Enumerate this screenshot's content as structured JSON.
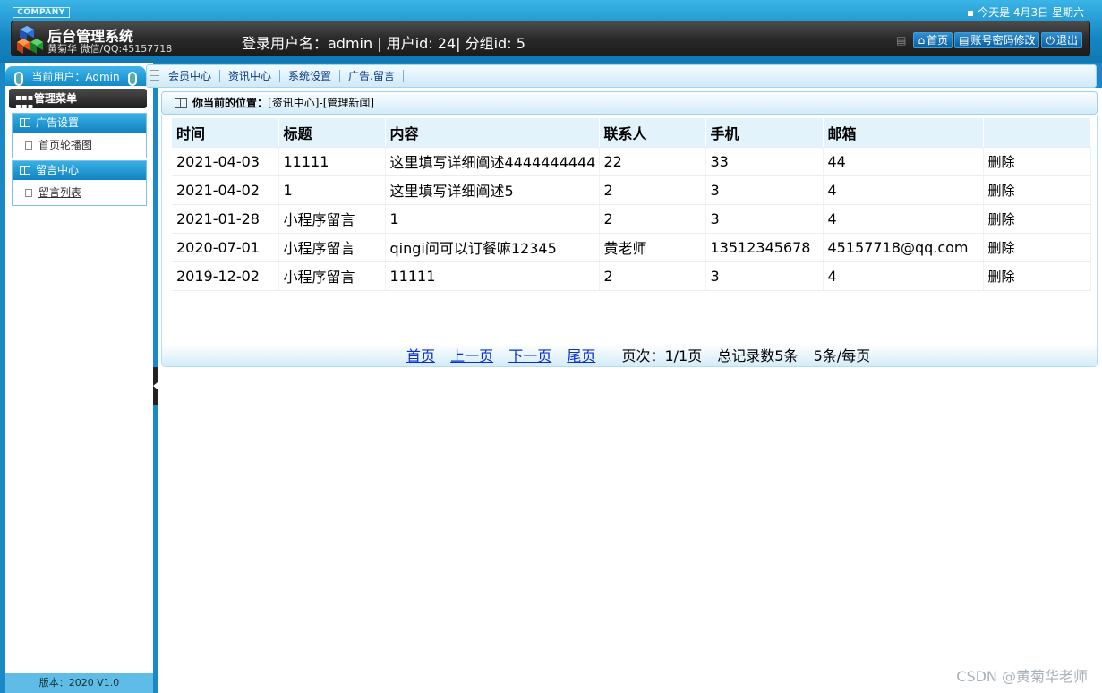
{
  "header": {
    "company": "COMPANY",
    "date": "今天是 4月3日 星期六",
    "title": "后台管理系统",
    "subtitle": "黄菊华 微信/QQ:45157718",
    "login_info": "登录用户名：admin | 用户id: 24| 分组id: 5",
    "buttons": [
      "首页",
      "账号密码修改",
      "退出"
    ]
  },
  "sidebar": {
    "current_user": "当前用户：Admin",
    "menu_title": "管理菜单",
    "groups": [
      {
        "title": "广告设置",
        "items": [
          "首页轮播图"
        ]
      },
      {
        "title": "留言中心",
        "items": [
          "留言列表"
        ]
      }
    ],
    "version": "版本：2020 V1.0"
  },
  "topnav": [
    "会员中心",
    "资讯中心",
    "系统设置",
    "广告.留言"
  ],
  "breadcrumb": {
    "label": "你当前的位置：",
    "path": "[资讯中心]-[管理新闻]"
  },
  "table": {
    "headers": [
      "时间",
      "标题",
      "内容",
      "联系人",
      "手机",
      "邮箱",
      ""
    ],
    "rows": [
      [
        "2021-04-03",
        "11111",
        "这里填写详细阐述4444444444",
        "22",
        "33",
        "44",
        "删除"
      ],
      [
        "2021-04-02",
        "1",
        "这里填写详细阐述5",
        "2",
        "3",
        "4",
        "删除"
      ],
      [
        "2021-01-28",
        "小程序留言",
        "1",
        "2",
        "3",
        "4",
        "删除"
      ],
      [
        "2020-07-01",
        "小程序留言",
        "qingi问可以订餐嘛12345",
        "黄老师",
        "13512345678",
        "45157718@qq.com",
        "删除"
      ],
      [
        "2019-12-02",
        "小程序留言",
        "11111",
        "2",
        "3",
        "4",
        "删除"
      ]
    ]
  },
  "pager": {
    "first": "首页",
    "prev": "上一页",
    "next": "下一页",
    "last": "尾页",
    "page_info": "页次：1/1页",
    "total": "总记录数5条",
    "per_page": "5条/每页"
  },
  "watermark": "CSDN @黄菊华老师"
}
